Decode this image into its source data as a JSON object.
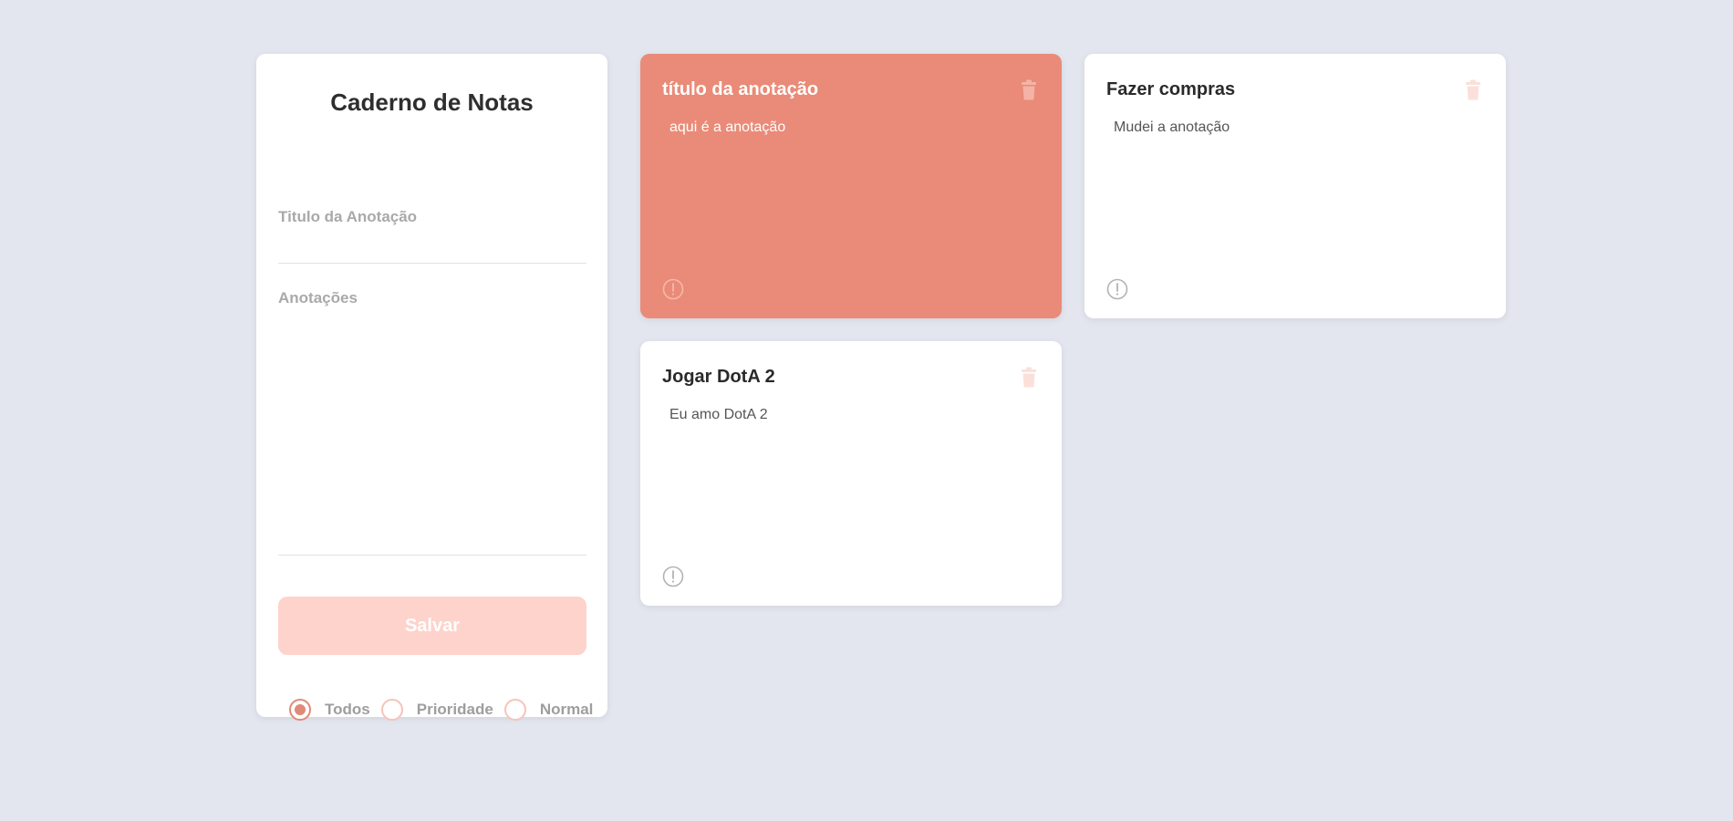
{
  "colors": {
    "background": "#e3e6ef",
    "accent": "#e98b78",
    "save_button": "#fdd3cc"
  },
  "form": {
    "title": "Caderno de Notas",
    "title_field": {
      "placeholder": "Titulo da Anotação",
      "value": ""
    },
    "notes_field": {
      "placeholder": "Anotações",
      "value": ""
    },
    "save_label": "Salvar",
    "filters": [
      {
        "label": "Todos",
        "checked": true
      },
      {
        "label": "Prioridade",
        "checked": false
      },
      {
        "label": "Normal",
        "checked": false
      }
    ]
  },
  "notes": [
    {
      "title": "título da anotação",
      "text": "aqui é a anotação",
      "priority": true,
      "trash_icon": "trash-icon",
      "alert_icon": "exclamation-circle-icon"
    },
    {
      "title": "Fazer compras",
      "text": "Mudei a anotação",
      "priority": false,
      "trash_icon": "trash-icon",
      "alert_icon": "exclamation-circle-icon"
    },
    {
      "title": "Jogar DotA 2",
      "text": "Eu amo DotA 2",
      "priority": false,
      "trash_icon": "trash-icon",
      "alert_icon": "exclamation-circle-icon"
    }
  ]
}
